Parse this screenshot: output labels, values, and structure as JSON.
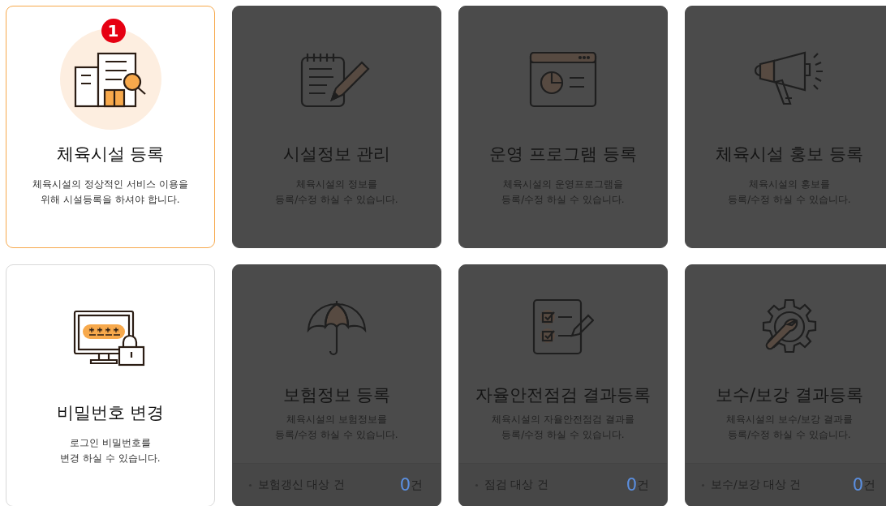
{
  "cards": [
    {
      "title": "체육시설 등록",
      "description": "체육시설의 정상적인 서비스 이용을\n위해 시설등록을 하셔야 합니다.",
      "dimmed": false,
      "selected": true,
      "badge": "1"
    },
    {
      "title": "시설정보 관리",
      "description": "체육시설의 정보를\n등록/수정 하실 수 있습니다.",
      "dimmed": true,
      "selected": false
    },
    {
      "title": "운영 프로그램 등록",
      "description": "체육시설의 운영프로그램을\n등록/수정 하실 수 있습니다.",
      "dimmed": true,
      "selected": false
    },
    {
      "title": "체육시설 홍보 등록",
      "description": "체육시설의 홍보를\n등록/수정 하실 수 있습니다.",
      "dimmed": true,
      "selected": false
    },
    {
      "title": "비밀번호 변경",
      "description": "로그인 비밀번호를\n변경 하실 수 있습니다.",
      "dimmed": false,
      "selected": false
    },
    {
      "title": "보험정보 등록",
      "description": "체육시설의 보험정보를\n등록/수정 하실 수 있습니다.",
      "dimmed": true,
      "selected": false,
      "footer": {
        "label": "보험갱신 대상 건",
        "count": "0",
        "unit": "건"
      }
    },
    {
      "title": "자율안전점검 결과등록",
      "description": "체육시설의 자율안전점검 결과를\n등록/수정 하실 수 있습니다.",
      "dimmed": true,
      "selected": false,
      "footer": {
        "label": "점검 대상 건",
        "count": "0",
        "unit": "건"
      }
    },
    {
      "title": "보수/보강 결과등록",
      "description": "체육시설의 보수/보강 결과를\n등록/수정 하실 수 있습니다.",
      "dimmed": true,
      "selected": false,
      "footer": {
        "label": "보수/보강 대상 건",
        "count": "0",
        "unit": "건"
      }
    }
  ]
}
